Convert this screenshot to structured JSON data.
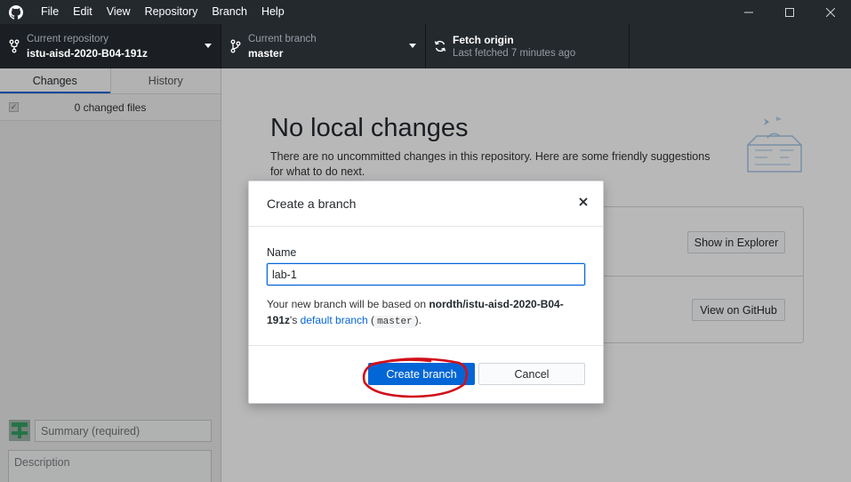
{
  "menu": {
    "items": [
      "File",
      "Edit",
      "View",
      "Repository",
      "Branch",
      "Help"
    ]
  },
  "toolbar": {
    "repo_label": "Current repository",
    "repo_value": "istu-aisd-2020-B04-191z",
    "branch_label": "Current branch",
    "branch_value": "master",
    "fetch_label": "Fetch origin",
    "fetch_value": "Last fetched 7 minutes ago"
  },
  "sidebar": {
    "tabs": [
      {
        "label": "Changes",
        "active": true
      },
      {
        "label": "History",
        "active": false
      }
    ],
    "changed_files": "0 changed files",
    "summary_placeholder": "Summary (required)",
    "description_placeholder": "Description"
  },
  "main": {
    "title": "No local changes",
    "subtitle": "There are no uncommitted changes in this repository. Here are some friendly suggestions for what to do next.",
    "show_in_explorer": "Show in Explorer",
    "view_on_github": "View on GitHub"
  },
  "dialog": {
    "title": "Create a branch",
    "field_label": "Name",
    "name_value": "lab-1",
    "help_prefix": "Your new branch will be based on ",
    "help_repo": "nordth/istu-aisd-2020-B04-191z",
    "help_suffix": "'s ",
    "help_link": "default branch",
    "help_paren_open": " (",
    "help_branch": "master",
    "help_paren_close": ").",
    "create_button": "Create branch",
    "cancel_button": "Cancel"
  },
  "colors": {
    "titlebar": "#24292e",
    "accent": "#0366d6",
    "annotation": "#d0101a"
  },
  "icons": {
    "app": "github-octocat-icon",
    "repo": "repo-fork-icon",
    "branch": "git-branch-icon",
    "fetch": "sync-icon",
    "close": "close-icon"
  }
}
